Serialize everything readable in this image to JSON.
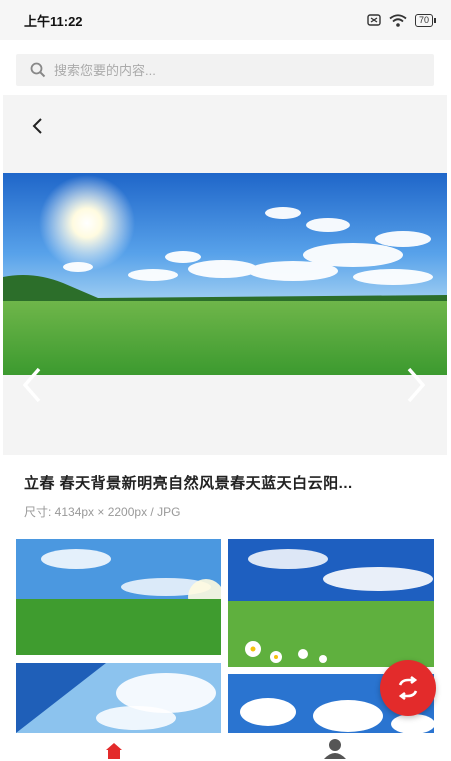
{
  "status_bar": {
    "time": "上午11:22",
    "battery": "70"
  },
  "search": {
    "placeholder": "搜索您要的内容..."
  },
  "detail": {
    "title": "立春 春天背景新明亮自然风景春天蓝天白云阳...",
    "size_info": "尺寸: 4134px × 2200px / JPG"
  },
  "icons": {
    "search": "search-icon",
    "back": "chevron-left-icon",
    "prev": "chevron-left-icon",
    "next": "chevron-right-icon",
    "refresh": "refresh-icon",
    "home": "home-icon",
    "profile": "user-icon",
    "wifi": "wifi-icon",
    "sim": "no-sim-icon"
  },
  "colors": {
    "accent": "#e32b2b",
    "sky": "#2f7fd6",
    "grass": "#4aa33a"
  }
}
